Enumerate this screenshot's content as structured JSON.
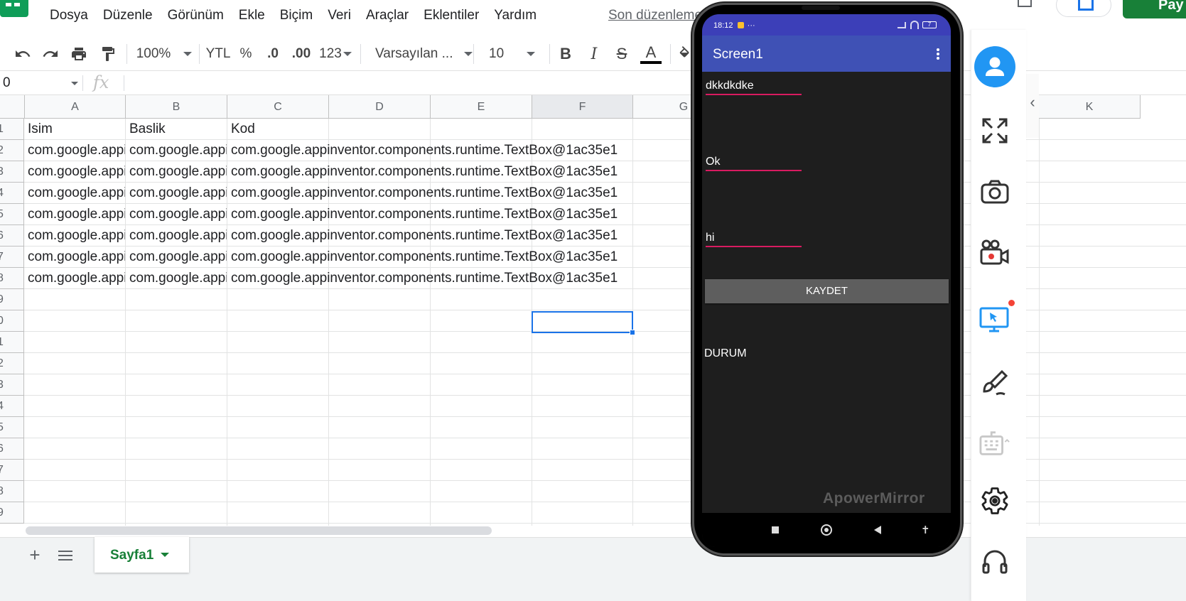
{
  "menu": [
    "Dosya",
    "Düzenle",
    "Görünüm",
    "Ekle",
    "Biçim",
    "Veri",
    "Araçlar",
    "Eklentiler",
    "Yardım"
  ],
  "last_edit": "Son düzenleme birkaç",
  "share_label": "Pay",
  "toolbar": {
    "zoom": "100%",
    "currency": "YTL",
    "percent": "%",
    "dec_less": ".0",
    "dec_more": ".00",
    "more_formats": "123",
    "font": "Varsayılan ...",
    "font_size": "10",
    "bold": "B",
    "italic": "I",
    "strike": "S",
    "text_color": "A"
  },
  "namebox": "0",
  "fx": "fx",
  "columns": [
    "A",
    "B",
    "C",
    "D",
    "E",
    "F",
    "G",
    "K"
  ],
  "selected_column": "F",
  "row_numbers": [
    "1",
    "2",
    "3",
    "4",
    "5",
    "6",
    "7",
    "8",
    "9",
    "0",
    "1",
    "2",
    "3",
    "4",
    "5",
    "6",
    "7",
    "8",
    "9"
  ],
  "header_row": [
    "Isim",
    "Baslik",
    "Kod"
  ],
  "data_rows": [
    [
      "com.google.appi",
      "com.google.appi",
      "com.google.appinventor.components.runtime.TextBox@1ac35e1"
    ],
    [
      "com.google.appi",
      "com.google.appi",
      "com.google.appinventor.components.runtime.TextBox@1ac35e1"
    ],
    [
      "com.google.appi",
      "com.google.appi",
      "com.google.appinventor.components.runtime.TextBox@1ac35e1"
    ],
    [
      "com.google.appi",
      "com.google.appi",
      "com.google.appinventor.components.runtime.TextBox@1ac35e1"
    ],
    [
      "com.google.appi",
      "com.google.appi",
      "com.google.appinventor.components.runtime.TextBox@1ac35e1"
    ],
    [
      "com.google.appi",
      "com.google.appi",
      "com.google.appinventor.components.runtime.TextBox@1ac35e1"
    ],
    [
      "com.google.appi",
      "com.google.appi",
      "com.google.appinventor.components.runtime.TextBox@1ac35e1"
    ]
  ],
  "sheet_tab": "Sayfa1",
  "add_sheet": "+",
  "phone": {
    "time": "18:12",
    "battery": "7",
    "screen_title": "Screen1",
    "field1": "dkkdkdke",
    "field2": "Ok",
    "field3": "hi",
    "save_button": "KAYDET",
    "status": "DURUM",
    "watermark": "ApowerMirror"
  },
  "side_icons": [
    "user-icon",
    "fullscreen-icon",
    "camera-icon",
    "video-record-icon",
    "screen-cast-icon",
    "paint-brush-icon",
    "keyboard-icon",
    "settings-icon",
    "headset-icon"
  ],
  "colors": {
    "accent": "#1a73e8",
    "brand_green": "#188038",
    "phone_appbar": "#3f51b5",
    "field_underline": "#d81b60",
    "sidebar_icon_blue": "#2196f3"
  }
}
